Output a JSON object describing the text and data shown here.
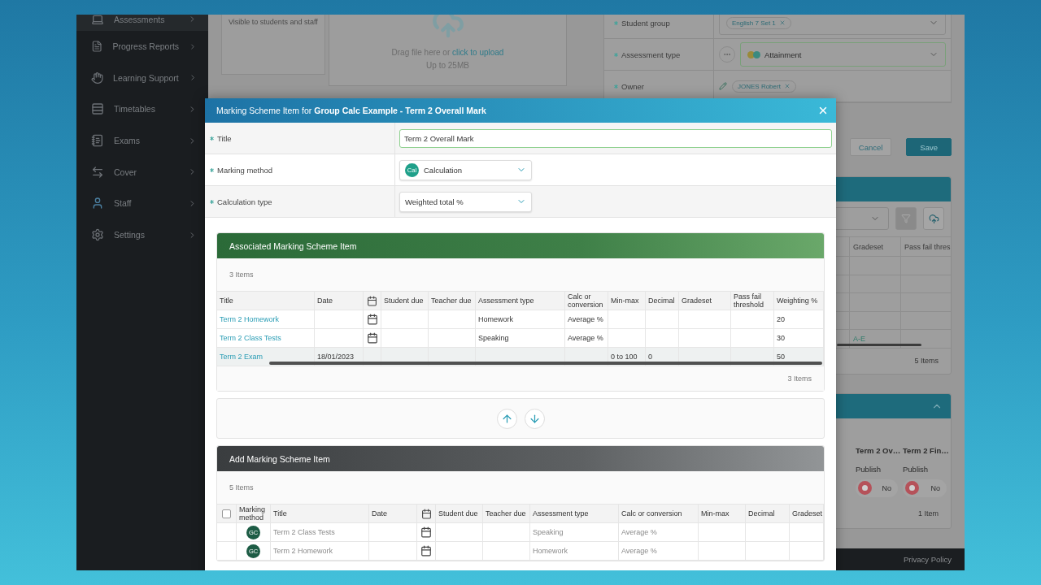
{
  "sidebar": {
    "items": [
      {
        "label": "Assessments",
        "selected": true
      },
      {
        "label": "Progress Reports",
        "selected": false
      },
      {
        "label": "Learning Support",
        "selected": false
      },
      {
        "label": "Timetables",
        "selected": false
      },
      {
        "label": "Exams",
        "selected": false
      },
      {
        "label": "Cover",
        "selected": false
      },
      {
        "label": "Staff",
        "selected": false
      },
      {
        "label": "Settings",
        "selected": false
      }
    ]
  },
  "page": {
    "visibility_note": "Visible to students and staff",
    "upload": {
      "prompt": "Drag file here or",
      "link": "click to upload",
      "limit": "Up to 25MB"
    },
    "form": [
      {
        "label": "Student group",
        "required": true,
        "kind": "tags",
        "tags": [
          "English 7 Set 1"
        ]
      },
      {
        "label": "Assessment type",
        "required": true,
        "kind": "select",
        "value": "Attainment"
      },
      {
        "label": "Owner",
        "required": true,
        "kind": "owner",
        "tags": [
          "JONES Robert"
        ]
      }
    ],
    "buttons": [
      {
        "label": "Cancel",
        "kind": "secondary"
      },
      {
        "label": "Save",
        "kind": "primary"
      }
    ],
    "results": {
      "columns": [
        "Gradeset",
        "Pass fail thres"
      ],
      "rows": [
        {},
        {},
        {},
        {},
        {
          "gradeset": "A-E"
        }
      ],
      "count": "5 Items"
    },
    "publish": {
      "expanded": true,
      "columns": [
        {
          "title": "Term 2 Ov…",
          "action": "Publish",
          "toggle": "No",
          "on": false
        },
        {
          "title": "Term 2 Fin…",
          "action": "Publish",
          "toggle": "No",
          "on": false
        }
      ],
      "count": "1 Item"
    },
    "footer": {
      "link": "Privacy Policy"
    }
  },
  "modal": {
    "title": "Marking Scheme Item for **Group Calc Example - Term 2 Overall Mark**",
    "fields": [
      {
        "label": "Title",
        "required": true,
        "kind": "text",
        "value": "Term 2 Overall Mark"
      },
      {
        "label": "Marking method",
        "required": true,
        "kind": "select",
        "badge": "Cal",
        "value": "Calculation"
      },
      {
        "label": "Calculation type",
        "required": true,
        "kind": "select",
        "value": "Weighted total %"
      }
    ],
    "associated": {
      "title": "Associated Marking Scheme Item",
      "count_top": "3 Items",
      "columns": [
        {
          "label": "Title"
        },
        {
          "label": "Date"
        },
        {
          "kind": "calendar"
        },
        {
          "label": "Student due"
        },
        {
          "label": "Teacher due"
        },
        {
          "label": "Assessment type"
        },
        {
          "label": "Calc or conversion"
        },
        {
          "label": "Min-max"
        },
        {
          "label": "Decimal"
        },
        {
          "label": "Gradeset"
        },
        {
          "label": "Pass fail threshold"
        },
        {
          "label": "Weighting %"
        }
      ],
      "rows": [
        {
          "title": "Term 2 Homework",
          "calendar": true,
          "assessment_type": "Homework",
          "calc": "Average %",
          "weighting": "20",
          "highlighted": false
        },
        {
          "title": "Term 2 Class Tests",
          "calendar": true,
          "assessment_type": "Speaking",
          "calc": "Average %",
          "weighting": "30",
          "highlighted": false
        },
        {
          "title": "Term 2 Exam",
          "date": "18/01/2023",
          "calendar": false,
          "min_max": "0 to 100",
          "decimal": "0",
          "weighting": "50",
          "highlighted": true
        }
      ],
      "count_bottom": "3 Items"
    },
    "move_buttons": [
      {
        "kind": "up"
      },
      {
        "kind": "down"
      }
    ],
    "add": {
      "title": "Add Marking Scheme Item",
      "count": "5 Items",
      "columns": [
        {
          "kind": "checkbox",
          "checked": false
        },
        {
          "label": "Marking method"
        },
        {
          "label": "Title"
        },
        {
          "label": "Date"
        },
        {
          "kind": "calendar"
        },
        {
          "label": "Student due"
        },
        {
          "label": "Teacher due"
        },
        {
          "label": "Assessment type"
        },
        {
          "label": "Calc or conversion"
        },
        {
          "label": "Min-max"
        },
        {
          "label": "Decimal"
        },
        {
          "label": "Gradeset"
        }
      ],
      "rows": [
        {
          "badge": "GC",
          "title": "Term 2 Class Tests",
          "calendar": true,
          "assessment_type": "Speaking",
          "calc": "Average %",
          "disabled": true
        },
        {
          "badge": "GC",
          "title": "Term 2 Homework",
          "calendar": true,
          "assessment_type": "Homework",
          "calc": "Average %",
          "disabled": true
        }
      ]
    }
  }
}
